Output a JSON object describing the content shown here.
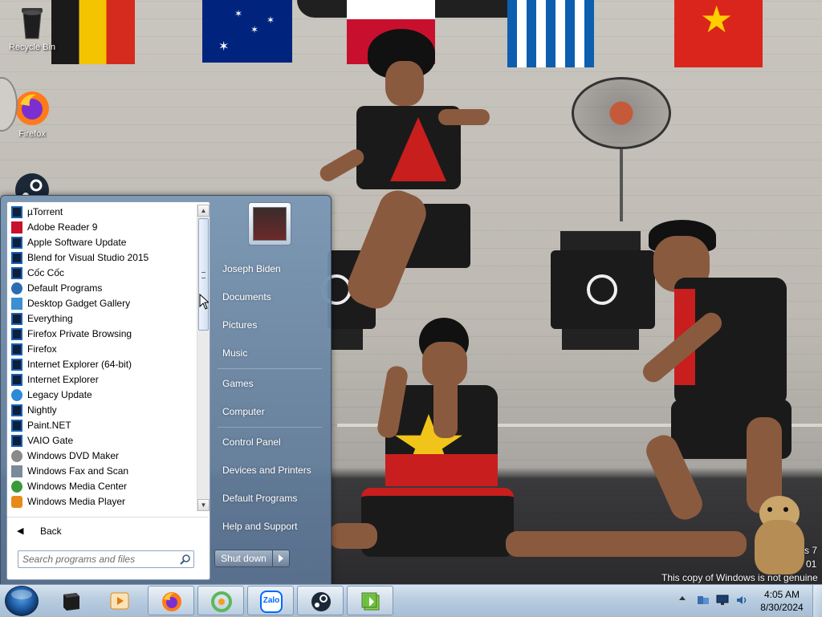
{
  "desktop": {
    "icons": [
      {
        "label": "Recycle Bin",
        "icon": "recycle-bin-icon"
      },
      {
        "label": "Firefox",
        "icon": "firefox-icon"
      },
      {
        "label": "",
        "icon": "steam-icon"
      }
    ],
    "watermark_line1": "This copy of Windows is not genuine",
    "watermark_corner": "s 7",
    "watermark_corner2": "01"
  },
  "start_menu": {
    "programs": [
      {
        "label": "µTorrent",
        "icon": "app-icon",
        "color": "#1a5fb4"
      },
      {
        "label": "Adobe Reader 9",
        "icon": "pdf-icon",
        "color": "#c8102e"
      },
      {
        "label": "Apple Software Update",
        "icon": "app-icon",
        "color": "#1a5fb4"
      },
      {
        "label": "Blend for Visual Studio 2015",
        "icon": "app-icon",
        "color": "#1a5fb4"
      },
      {
        "label": "Cốc Cốc",
        "icon": "app-icon",
        "color": "#1a5fb4"
      },
      {
        "label": "Default Programs",
        "icon": "globe-icon",
        "color": "#2b6cb3"
      },
      {
        "label": "Desktop Gadget Gallery",
        "icon": "gadget-icon",
        "color": "#3d8fd1"
      },
      {
        "label": "Everything",
        "icon": "app-icon",
        "color": "#1a5fb4"
      },
      {
        "label": "Firefox Private Browsing",
        "icon": "app-icon",
        "color": "#1a5fb4"
      },
      {
        "label": "Firefox",
        "icon": "app-icon",
        "color": "#1a5fb4"
      },
      {
        "label": "Internet Explorer (64-bit)",
        "icon": "app-icon",
        "color": "#1a5fb4"
      },
      {
        "label": "Internet Explorer",
        "icon": "app-icon",
        "color": "#1a5fb4"
      },
      {
        "label": "Legacy Update",
        "icon": "update-icon",
        "color": "#2a8bd9"
      },
      {
        "label": "Nightly",
        "icon": "app-icon",
        "color": "#1a5fb4"
      },
      {
        "label": "Paint.NET",
        "icon": "app-icon",
        "color": "#1a5fb4"
      },
      {
        "label": "VAIO Gate",
        "icon": "app-icon",
        "color": "#1a5fb4"
      },
      {
        "label": "Windows DVD Maker",
        "icon": "dvd-icon",
        "color": "#8a8a8a"
      },
      {
        "label": "Windows Fax and Scan",
        "icon": "fax-icon",
        "color": "#7a8b99"
      },
      {
        "label": "Windows Media Center",
        "icon": "media-center-icon",
        "color": "#3a9a3a"
      },
      {
        "label": "Windows Media Player",
        "icon": "media-player-icon",
        "color": "#e88a1a"
      }
    ],
    "back_label": "Back",
    "search_placeholder": "Search programs and files",
    "right_items": [
      {
        "label": "Joseph Biden"
      },
      {
        "label": "Documents"
      },
      {
        "label": "Pictures"
      },
      {
        "label": "Music"
      },
      {
        "label": "Games"
      },
      {
        "label": "Computer"
      },
      {
        "label": "Control Panel"
      },
      {
        "label": "Devices and Printers"
      },
      {
        "label": "Default Programs"
      },
      {
        "label": "Help and Support"
      }
    ],
    "shutdown_label": "Shut down"
  },
  "taskbar": {
    "pinned": [
      {
        "name": "explorer-icon",
        "active": false
      },
      {
        "name": "media-player-icon",
        "active": false
      },
      {
        "name": "firefox-icon",
        "active": true
      },
      {
        "name": "coccoc-icon",
        "active": true
      },
      {
        "name": "zalo-icon",
        "active": true
      },
      {
        "name": "steam-icon",
        "active": true
      },
      {
        "name": "teracopy-icon",
        "active": true
      }
    ],
    "zalo_text": "Zalo",
    "clock_time": "4:05 AM",
    "clock_date": "8/30/2024"
  }
}
